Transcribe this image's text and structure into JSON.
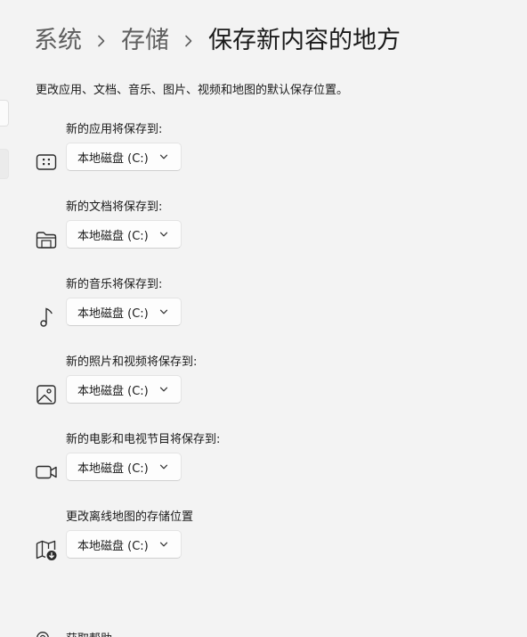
{
  "breadcrumb": {
    "items": [
      "系统",
      "存储",
      "保存新内容的地方"
    ]
  },
  "description": "更改应用、文档、音乐、图片、视频和地图的默认保存位置。",
  "rows": [
    {
      "label": "新的应用将保存到:",
      "value": "本地磁盘 (C:)",
      "icon": "app-icon"
    },
    {
      "label": "新的文档将保存到:",
      "value": "本地磁盘 (C:)",
      "icon": "folder-icon"
    },
    {
      "label": "新的音乐将保存到:",
      "value": "本地磁盘 (C:)",
      "icon": "music-note-icon"
    },
    {
      "label": "新的照片和视频将保存到:",
      "value": "本地磁盘 (C:)",
      "icon": "photo-icon"
    },
    {
      "label": "新的电影和电视节目将保存到:",
      "value": "本地磁盘 (C:)",
      "icon": "video-camera-icon"
    },
    {
      "label": "更改离线地图的存储位置",
      "value": "本地磁盘 (C:)",
      "icon": "map-download-icon"
    }
  ],
  "help": {
    "label": "获取帮助",
    "icon": "help-icon"
  }
}
